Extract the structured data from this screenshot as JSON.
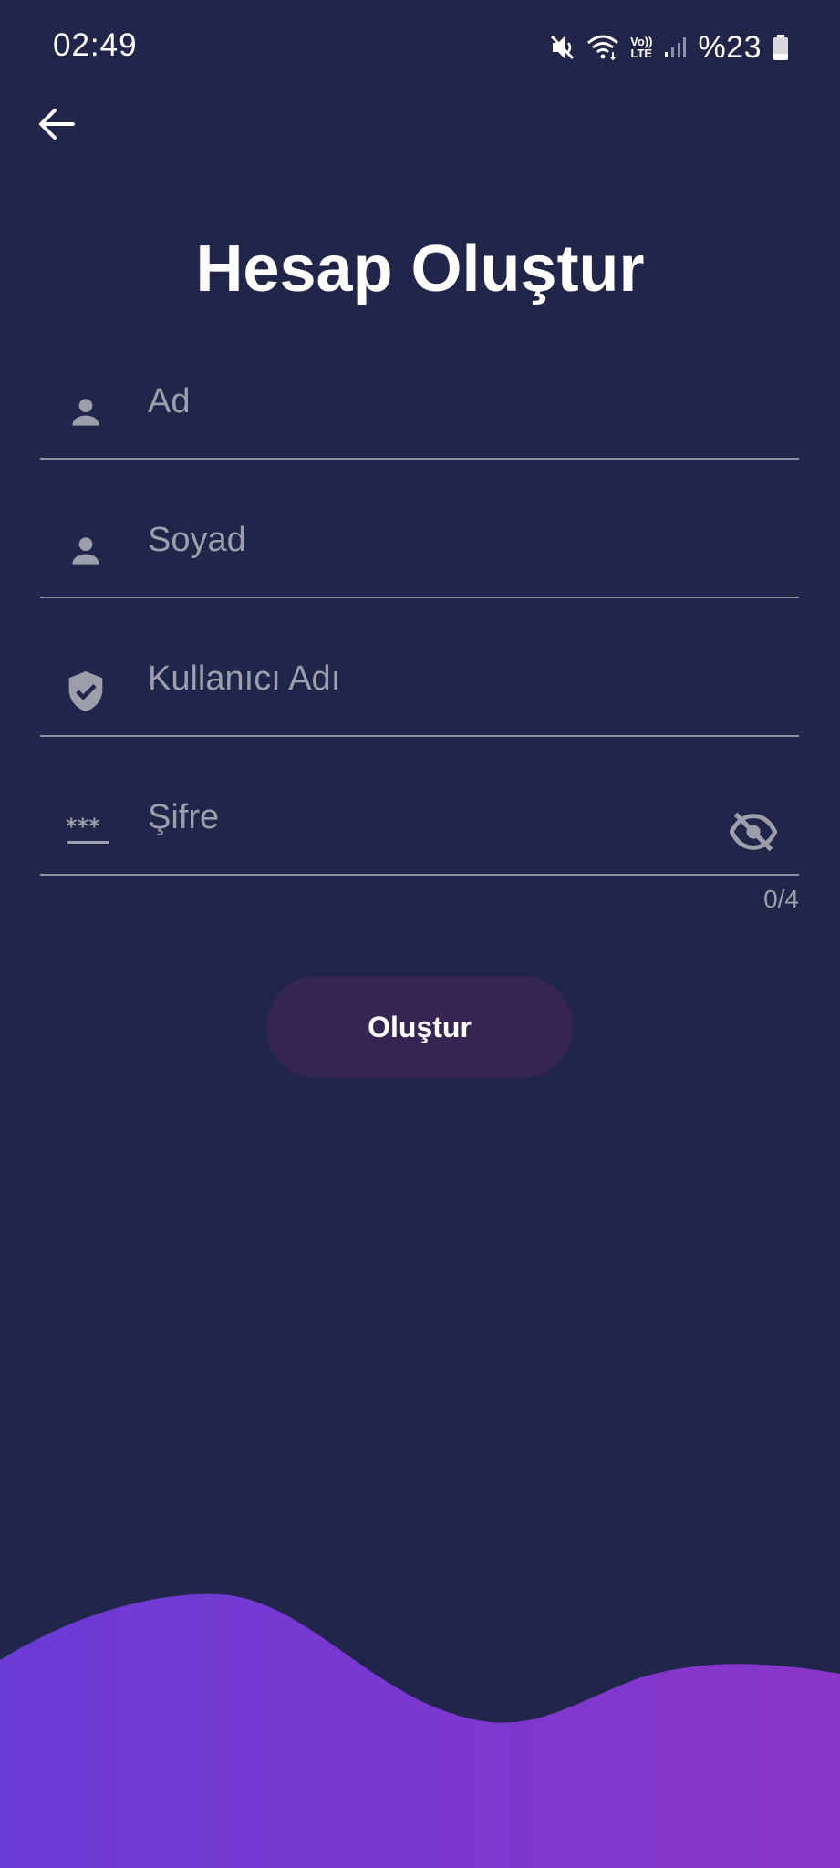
{
  "status_bar": {
    "time": "02:49",
    "battery": "%23",
    "volte_top": "Vo))",
    "volte_bottom": "LTE",
    "icons": [
      "mute-icon",
      "wifi-icon",
      "volte-icon",
      "signal-icon",
      "battery-icon"
    ]
  },
  "header": {
    "back_icon": "arrow-left-icon",
    "title": "Hesap Oluştur"
  },
  "form": {
    "first_name": {
      "placeholder": "Ad",
      "value": "",
      "icon": "person-icon"
    },
    "last_name": {
      "placeholder": "Soyad",
      "value": "",
      "icon": "person-icon"
    },
    "username": {
      "placeholder": "Kullanıcı Adı",
      "value": "",
      "icon": "shield-check-icon"
    },
    "password": {
      "placeholder": "Şifre",
      "value": "",
      "icon": "password-icon",
      "toggle_icon": "eye-off-icon",
      "counter": "0/4"
    },
    "submit_label": "Oluştur"
  },
  "colors": {
    "background": "#22254a",
    "input_text": "#9c9eab",
    "button_bg": "#342650",
    "wave_start": "#6b3bd6",
    "wave_end": "#8a35c8"
  }
}
